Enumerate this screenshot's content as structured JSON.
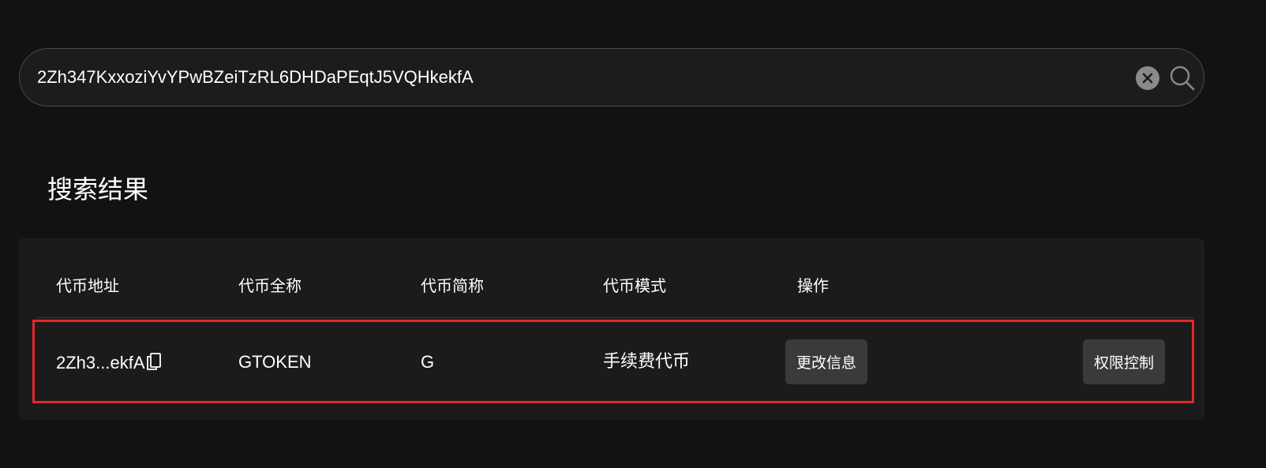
{
  "search": {
    "value": "2Zh347KxxoziYvYPwBZeiTzRL6DHDaPEqtJ5VQHkekfA",
    "placeholder": ""
  },
  "results": {
    "title": "搜索结果",
    "columns": [
      "代币地址",
      "代币全称",
      "代币简称",
      "代币模式",
      "操作"
    ],
    "rows": [
      {
        "address_short": "2Zh3...ekfA",
        "full_name": "GTOKEN",
        "short_name": "G",
        "mode": "手续费代币",
        "actions": [
          "更改信息",
          "权限控制"
        ]
      }
    ]
  },
  "icons": {
    "clear": "close-circle-icon",
    "search": "search-icon",
    "copy": "copy-icon"
  },
  "colors": {
    "background": "#121212",
    "card": "#1b1b1b",
    "highlight_border": "#e0282e",
    "button": "#3a3a3a"
  }
}
